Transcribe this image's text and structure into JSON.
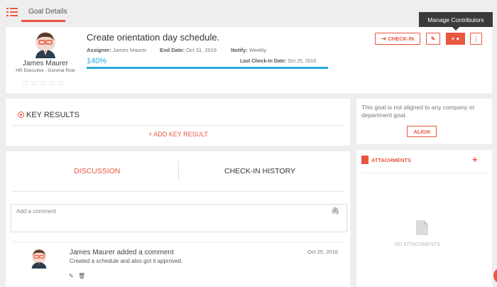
{
  "nav": {
    "tab_label": "Goal Details"
  },
  "tooltip": {
    "text": "Manage Contributors"
  },
  "goal": {
    "title": "Create orientation day schedule.",
    "assigner_label": "Assigner:",
    "assigner_value": "James Maurer",
    "end_date_label": "End Date:",
    "end_date_value": "Oct 31, 2016",
    "notify_label": "Notify:",
    "notify_value": "Weekly",
    "progress_text": "140%",
    "progress_fraction": 1.0,
    "last_checkin_label": "Last Check-In Date:",
    "last_checkin_value": "Oct 25, 2016"
  },
  "owner": {
    "name": "James Maurer",
    "role": "HR Executive - General Role",
    "rating_stars": 0,
    "rating_max": 5
  },
  "actions": {
    "checkin_label": "CHECK-IN",
    "contributors_label": "+"
  },
  "key_results": {
    "title": "KEY RESULTS",
    "add_label": "+ ADD KEY RESULT"
  },
  "alignment": {
    "message": "This goal is not aligned to any company or department goal.",
    "align_label": "ALIGN"
  },
  "discussion": {
    "tab_discussion": "DISCUSSION",
    "tab_history": "CHECK-IN HISTORY",
    "comment_placeholder": "Add a comment",
    "comments": [
      {
        "author_line": "James Maurer added a comment",
        "text": "Created a schedule and also got it approved.",
        "date": "Oct 25, 2016"
      }
    ]
  },
  "attachments": {
    "title": "ATTACHMENTS",
    "empty_text": "NO ATTACHMENTS"
  },
  "colors": {
    "accent": "#e8563f",
    "progress": "#29a9e0"
  }
}
